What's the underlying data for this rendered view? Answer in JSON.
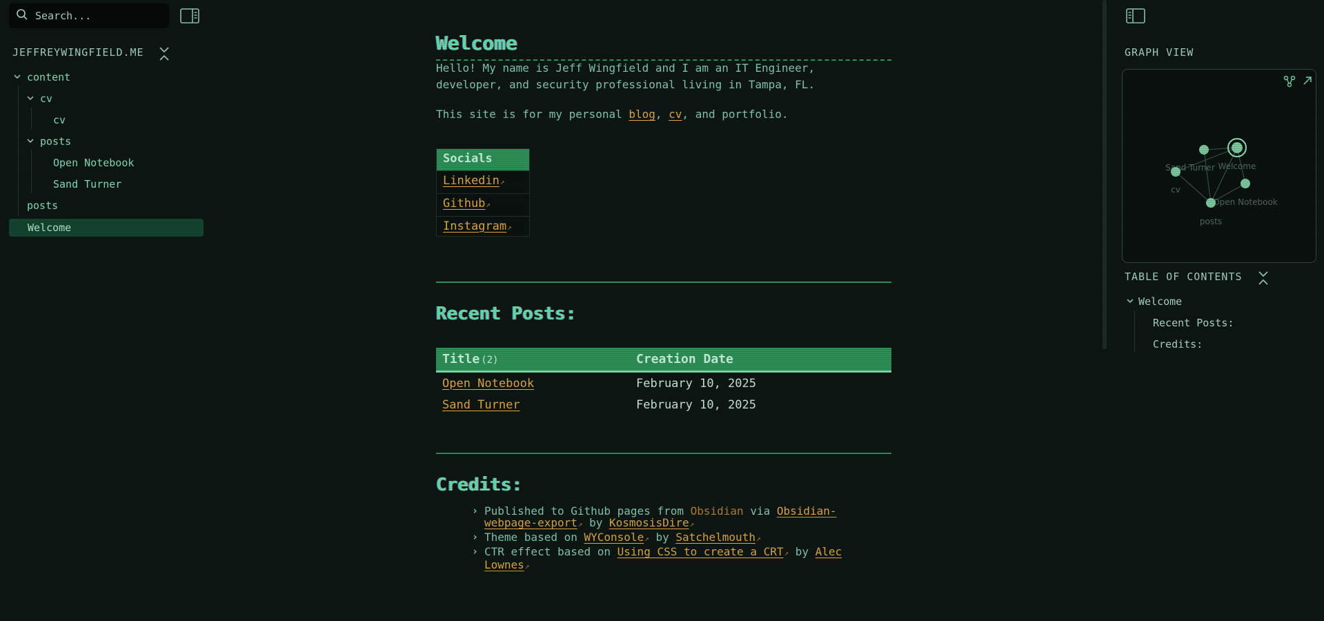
{
  "sidebar": {
    "search_placeholder": "Search...",
    "site_title": "JEFFREYWINGFIELD.ME",
    "tree": {
      "content": "content",
      "cv_folder": "cv",
      "cv_file": "cv",
      "posts_folder": "posts",
      "open_notebook": "Open Notebook",
      "sand_turner": "Sand Turner",
      "posts_file": "posts",
      "welcome": "Welcome"
    }
  },
  "main": {
    "title": "Welcome",
    "intro_line1": "Hello! My name is Jeff Wingfield and I am an IT Engineer,",
    "intro_line2": "developer, and security professional living in Tampa, FL.",
    "site_for_prefix": "This site is for my personal ",
    "blog_link": "blog",
    "comma_sep": ", ",
    "cv_link": "cv",
    "site_for_suffix": ", and portfolio.",
    "socials": {
      "header": "Socials",
      "items": [
        "Linkedin",
        "Github",
        "Instagram"
      ]
    },
    "recent_heading": "Recent Posts:",
    "posts_table": {
      "col_title": "Title",
      "col_count": "(2)",
      "col_date": "Creation Date",
      "rows": [
        {
          "title": "Open Notebook",
          "date": "February 10, 2025"
        },
        {
          "title": "Sand Turner",
          "date": "February 10, 2025"
        }
      ]
    },
    "credits_heading": "Credits:",
    "credits": {
      "c1_pre": "Published to Github pages from ",
      "c1_obsidian": "Obsidian",
      "c1_via": " via ",
      "c1_export": "Obsidian-webpage-export",
      "c1_by": " by ",
      "c1_author": "KosmosisDire",
      "c2_pre": "Theme based on ",
      "c2_theme": "WYConsole",
      "c2_by": " by ",
      "c2_author": "Satchelmouth",
      "c3_pre": "CTR effect based on ",
      "c3_link": "Using CSS to create a CRT",
      "c3_by": " by ",
      "c3_author": "Alec Lownes"
    }
  },
  "right": {
    "graph_title": "GRAPH VIEW",
    "graph_nodes": [
      "Welcome",
      "Sand Turner",
      "cv",
      "Open Notebook",
      "posts"
    ],
    "toc_title": "TABLE OF CONTENTS",
    "toc": {
      "welcome": "Welcome",
      "recent": "Recent Posts:",
      "credits": "Credits:"
    }
  },
  "colors": {
    "background": "#0d1613",
    "accent_green": "#2c8f56",
    "heading_green": "#5fe0a4",
    "link_orange": "#e0a83a"
  }
}
